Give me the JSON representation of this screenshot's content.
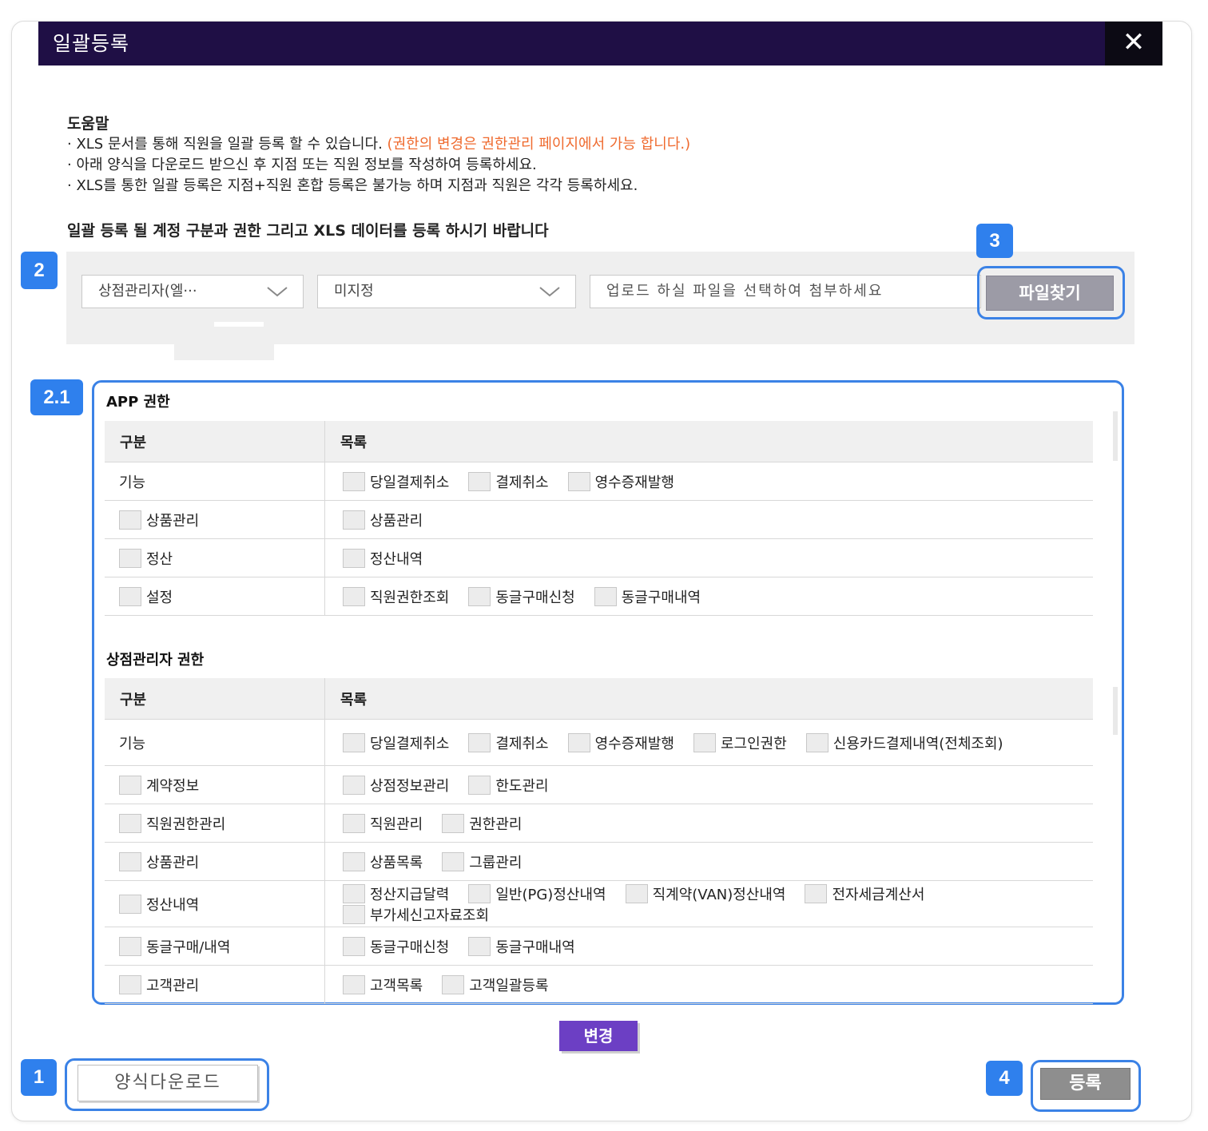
{
  "dialog": {
    "title": "일괄등록",
    "close_glyph": "✕"
  },
  "help": {
    "title": "도움말",
    "line1": "· XLS 문서를 통해 직원을 일괄 등록 할 수 있습니다.",
    "line1_note": "(권한의 변경은 권한관리 페이지에서 가능 합니다.)",
    "line2": "· 아래 양식을 다운로드 받으신 후 지점 또는 직원 정보를 작성하여 등록하세요.",
    "line3": "· XLS를 통한 일괄 등록은 지점+직원 혼합 등록은 불가능 하며 지점과 직원은 각각 등록하세요."
  },
  "instruction": "일괄 등록 될 계정 구분과 권한 그리고 XLS 데이터를 등록 하시기 바랍니다",
  "filters": {
    "account_type": "상점관리자(엘···",
    "branch": "미지정",
    "file_placeholder": "업로드 하실 파일을 선택하여 첨부하세요",
    "file_button": "파일찾기"
  },
  "badges": {
    "b1": "1",
    "b2": "2",
    "b21": "2.1",
    "b3": "3",
    "b4": "4"
  },
  "app_permissions": {
    "title": "APP 권한",
    "col1": "구분",
    "col2": "목록",
    "rows": [
      {
        "category": "기능",
        "items": [
          "당일결제취소",
          "결제취소",
          "영수증재발행"
        ]
      },
      {
        "category": "상품관리",
        "items": [
          "상품관리"
        ]
      },
      {
        "category": "정산",
        "items": [
          "정산내역"
        ]
      },
      {
        "category": "설정",
        "items": [
          "직원권한조회",
          "동글구매신청",
          "동글구매내역"
        ]
      }
    ]
  },
  "store_permissions": {
    "title": "상점관리자 권한",
    "col1": "구분",
    "col2": "목록",
    "rows": [
      {
        "category": "기능",
        "items": [
          "당일결제취소",
          "결제취소",
          "영수증재발행",
          "로그인권한",
          "신용카드결제내역(전체조회)"
        ]
      },
      {
        "category": "계약정보",
        "items": [
          "상점정보관리",
          "한도관리"
        ]
      },
      {
        "category": "직원권한관리",
        "items": [
          "직원관리",
          "권한관리"
        ]
      },
      {
        "category": "상품관리",
        "items": [
          "상품목록",
          "그룹관리"
        ]
      },
      {
        "category": "정산내역",
        "items": [
          "정산지급달력",
          "일반(PG)정산내역",
          "직계약(VAN)정산내역",
          "전자세금계산서",
          "부가세신고자료조회"
        ]
      },
      {
        "category": "동글구매/내역",
        "items": [
          "동글구매신청",
          "동글구매내역"
        ]
      },
      {
        "category": "고객관리",
        "items": [
          "고객목록",
          "고객일괄등록"
        ]
      }
    ]
  },
  "buttons": {
    "change": "변경",
    "download": "양식다운로드",
    "register": "등록"
  }
}
